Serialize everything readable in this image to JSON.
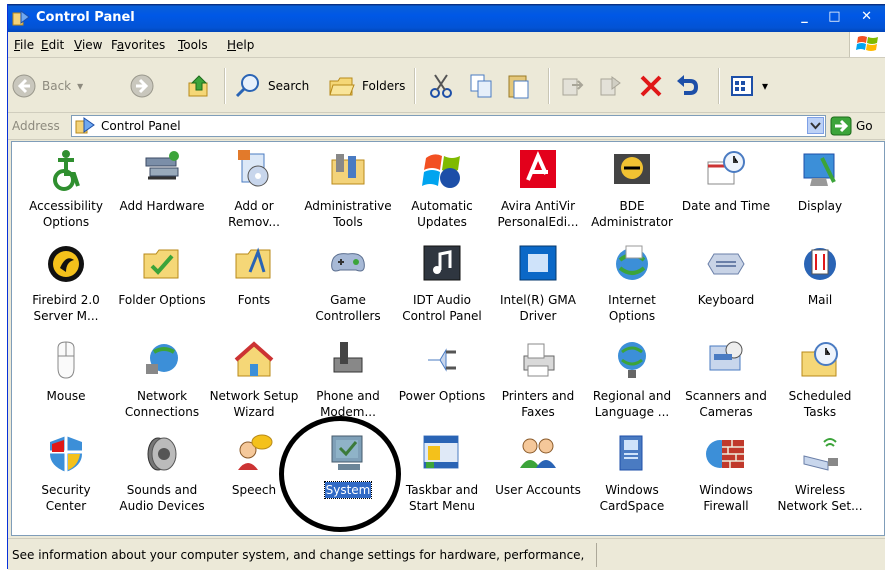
{
  "window": {
    "title": "Control Panel",
    "menu": [
      "File",
      "Edit",
      "View",
      "Favorites",
      "Tools",
      "Help"
    ],
    "menu_underline": [
      "F",
      "E",
      "V",
      "a",
      "T",
      "H"
    ]
  },
  "toolbar": {
    "back_label": "Back",
    "search_label": "Search",
    "folders_label": "Folders"
  },
  "address": {
    "label": "Address",
    "value": "Control Panel",
    "go_label": "Go"
  },
  "items": [
    {
      "label": "Accessibility\nOptions",
      "icon": "accessibility-icon"
    },
    {
      "label": "Add Hardware",
      "icon": "add-hardware-icon"
    },
    {
      "label": "Add or\nRemov...",
      "icon": "add-remove-programs-icon"
    },
    {
      "label": "Administrative\nTools",
      "icon": "administrative-tools-icon"
    },
    {
      "label": "Automatic\nUpdates",
      "icon": "automatic-updates-icon"
    },
    {
      "label": "Avira AntiVir\nPersonalEdi...",
      "icon": "avira-icon"
    },
    {
      "label": "BDE\nAdministrator",
      "icon": "bde-administrator-icon"
    },
    {
      "label": "Date and Time",
      "icon": "date-time-icon"
    },
    {
      "label": "Display",
      "icon": "display-icon"
    },
    {
      "label": "Firebird 2.0\nServer M...",
      "icon": "firebird-icon"
    },
    {
      "label": "Folder Options",
      "icon": "folder-options-icon"
    },
    {
      "label": "Fonts",
      "icon": "fonts-icon"
    },
    {
      "label": "Game\nControllers",
      "icon": "game-controllers-icon"
    },
    {
      "label": "IDT Audio\nControl Panel",
      "icon": "idt-audio-icon"
    },
    {
      "label": "Intel(R) GMA\nDriver",
      "icon": "intel-gma-icon"
    },
    {
      "label": "Internet\nOptions",
      "icon": "internet-options-icon"
    },
    {
      "label": "Keyboard",
      "icon": "keyboard-icon"
    },
    {
      "label": "Mail",
      "icon": "mail-icon"
    },
    {
      "label": "Mouse",
      "icon": "mouse-icon"
    },
    {
      "label": "Network\nConnections",
      "icon": "network-connections-icon"
    },
    {
      "label": "Network Setup\nWizard",
      "icon": "network-setup-icon"
    },
    {
      "label": "Phone and\nModem...",
      "icon": "phone-modem-icon"
    },
    {
      "label": "Power Options",
      "icon": "power-options-icon"
    },
    {
      "label": "Printers and\nFaxes",
      "icon": "printers-faxes-icon"
    },
    {
      "label": "Regional and\nLanguage ...",
      "icon": "regional-language-icon"
    },
    {
      "label": "Scanners and\nCameras",
      "icon": "scanners-cameras-icon"
    },
    {
      "label": "Scheduled\nTasks",
      "icon": "scheduled-tasks-icon"
    },
    {
      "label": "Security\nCenter",
      "icon": "security-center-icon"
    },
    {
      "label": "Sounds and\nAudio Devices",
      "icon": "sounds-audio-icon"
    },
    {
      "label": "Speech",
      "icon": "speech-icon"
    },
    {
      "label": "System",
      "icon": "system-icon",
      "selected": true
    },
    {
      "label": "Taskbar and\nStart Menu",
      "icon": "taskbar-start-menu-icon"
    },
    {
      "label": "User Accounts",
      "icon": "user-accounts-icon"
    },
    {
      "label": "Windows\nCardSpace",
      "icon": "cardspace-icon"
    },
    {
      "label": "Windows\nFirewall",
      "icon": "firewall-icon"
    },
    {
      "label": "Wireless\nNetwork Set...",
      "icon": "wireless-network-icon"
    }
  ],
  "status": {
    "text": "See information about your computer system, and change settings for hardware, performance,"
  },
  "colors": {
    "title_bar": "#0058e6",
    "selection": "#316ac5",
    "chrome": "#ece9d8"
  }
}
